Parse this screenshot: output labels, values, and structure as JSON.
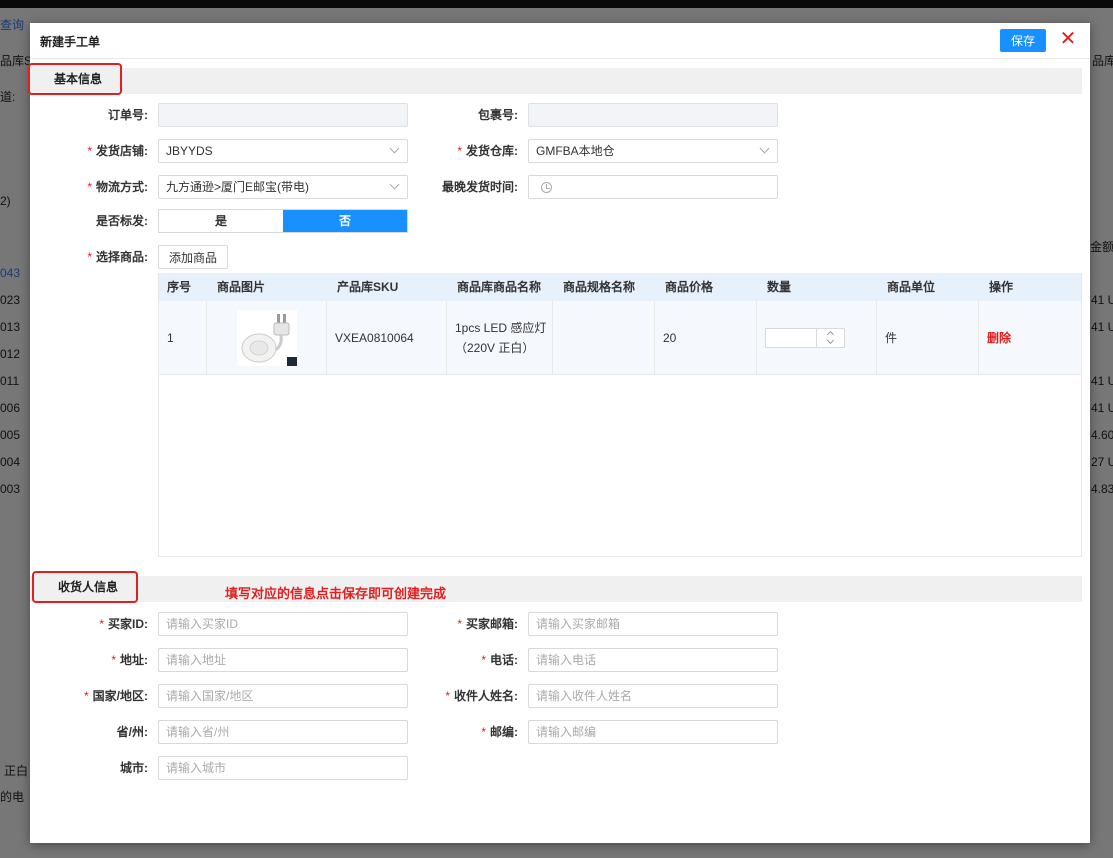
{
  "dialog": {
    "title": "新建手工单",
    "save_label": "保存",
    "close_glyph": "✕"
  },
  "sections": {
    "basic": "基本信息",
    "receiver": "收货人信息",
    "receiver_hint": "填写对应的信息点击保存即可创建完成"
  },
  "basic": {
    "order_no": {
      "label": "订单号:",
      "value": ""
    },
    "package_no": {
      "label": "包裹号:",
      "value": ""
    },
    "shop": {
      "label": "发货店铺:",
      "value": "JBYYDS",
      "required": "*"
    },
    "warehouse": {
      "label": "发货仓库:",
      "value": "GMFBA本地仓",
      "required": "*"
    },
    "logistics": {
      "label": "物流方式:",
      "value": "九方通逊>厦门E邮宝(带电)",
      "required": "*"
    },
    "latest_ship": {
      "label": "最晚发货时间:",
      "value": ""
    },
    "mark_ship": {
      "label": "是否标发:",
      "yes": "是",
      "no": "否",
      "selected": "否"
    },
    "select_goods": {
      "label": "选择商品:",
      "button": "添加商品",
      "required": "*"
    }
  },
  "table": {
    "headers": [
      "序号",
      "商品图片",
      "产品库SKU",
      "商品库商品名称",
      "商品规格名称",
      "商品价格",
      "数量",
      "商品单位",
      "操作"
    ],
    "rows": [
      {
        "index": "1",
        "sku": "VXEA0810064",
        "name_line1": "1pcs LED 感应灯",
        "name_line2": "（220V 正白）",
        "spec": "",
        "price": "20",
        "quantity": "",
        "unit": "件",
        "action": "删除"
      }
    ]
  },
  "receiver": {
    "buyer_id": {
      "label": "买家ID:",
      "placeholder": "请输入买家ID",
      "required": "*"
    },
    "buyer_email": {
      "label": "买家邮箱:",
      "placeholder": "请输入买家邮箱",
      "required": "*"
    },
    "address": {
      "label": "地址:",
      "placeholder": "请输入地址",
      "required": "*"
    },
    "phone": {
      "label": "电话:",
      "placeholder": "请输入电话",
      "required": "*"
    },
    "country": {
      "label": "国家/地区:",
      "placeholder": "请输入国家/地区",
      "required": "*"
    },
    "name": {
      "label": "收件人姓名:",
      "placeholder": "请输入收件人姓名",
      "required": "*"
    },
    "province": {
      "label": "省/州:",
      "placeholder": "请输入省/州"
    },
    "zip": {
      "label": "邮编:",
      "placeholder": "请输入邮编",
      "required": "*"
    },
    "city": {
      "label": "城市:",
      "placeholder": "请输入城市"
    }
  },
  "background": {
    "texts": [
      "查询",
      "品库S",
      "道:",
      "2)",
      "043",
      "023",
      "013",
      "012",
      "011",
      "006",
      "005",
      "004",
      "003",
      "正白",
      "的电",
      "品库",
      "金额",
      "41 U",
      "41 U",
      "41 U",
      "41 U",
      "4.60",
      "27 U",
      "4.83"
    ]
  },
  "colors": {
    "primary": "#1890ff",
    "danger": "#e02020",
    "header_bg": "#e6f1fc"
  }
}
